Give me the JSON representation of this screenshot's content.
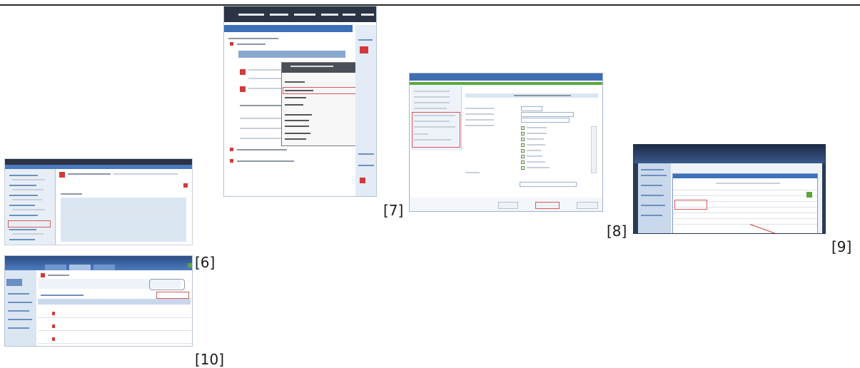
{
  "captions": {
    "c6": "[6]",
    "c7": "[7]",
    "c8": "[8]",
    "c9": "[9]",
    "c10": "[10]"
  },
  "colors": {
    "dark_bar": "#2b3445",
    "blue_header": "#3d70b8",
    "light_blue": "#dbe6f3",
    "highlight_red": "#d65a5a",
    "green_bar": "#5aa83c"
  },
  "thumbnails": [
    {
      "id": "6",
      "description_icon": "screenshot-thumbnail-icon"
    },
    {
      "id": "7",
      "description_icon": "screenshot-thumbnail-icon"
    },
    {
      "id": "8",
      "description_icon": "screenshot-thumbnail-icon"
    },
    {
      "id": "9",
      "description_icon": "screenshot-thumbnail-icon"
    },
    {
      "id": "10",
      "description_icon": "screenshot-thumbnail-icon"
    }
  ]
}
